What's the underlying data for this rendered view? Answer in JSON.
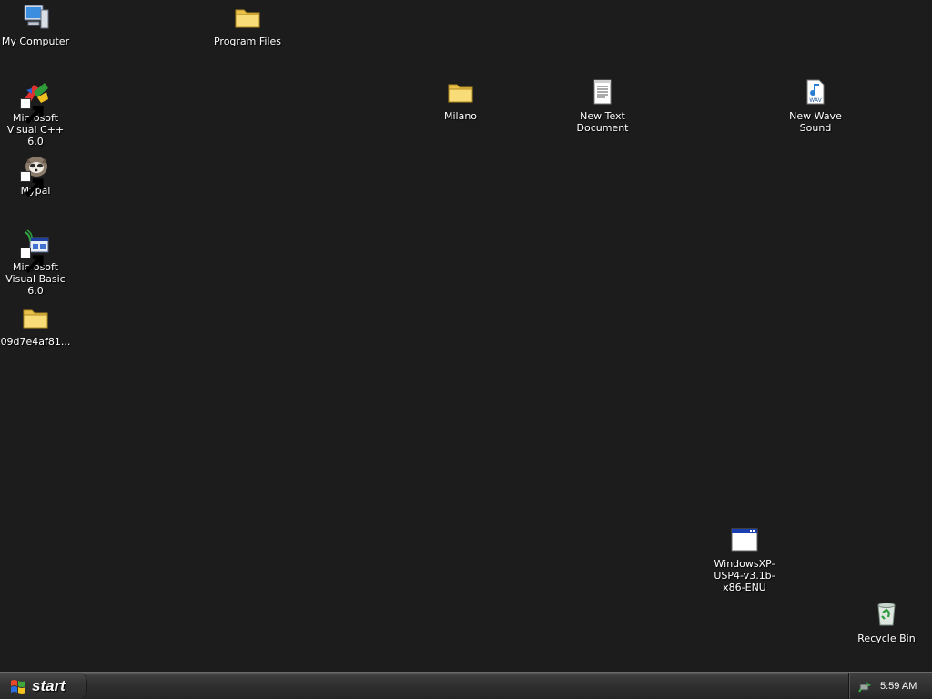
{
  "desktop": {
    "icons": [
      {
        "label": "My Computer",
        "icon": "my-computer-icon"
      },
      {
        "label": "Program Files",
        "icon": "folder-icon"
      },
      {
        "label": "Microsoft Visual C++ 6.0",
        "icon": "visual-cpp-icon"
      },
      {
        "label": "Milano",
        "icon": "folder-icon"
      },
      {
        "label": "New Text Document",
        "icon": "text-document-icon"
      },
      {
        "label": "New Wave Sound",
        "icon": "wav-file-icon"
      },
      {
        "label": "Mypal",
        "icon": "mypal-browser-icon"
      },
      {
        "label": "Microsoft Visual Basic 6.0",
        "icon": "visual-basic-icon"
      },
      {
        "label": "09d7e4af81...",
        "icon": "folder-icon"
      },
      {
        "label": "WindowsXP-USP4-v3.1b-x86-ENU",
        "icon": "application-window-icon"
      },
      {
        "label": "Recycle Bin",
        "icon": "recycle-bin-icon"
      }
    ]
  },
  "taskbar": {
    "start_label": "start",
    "clock": "5:59 AM"
  },
  "colors": {
    "desktop_background": "#1c1c1c",
    "folder_yellow": "#f5d66b",
    "taskbar": "#2f2f2f"
  }
}
